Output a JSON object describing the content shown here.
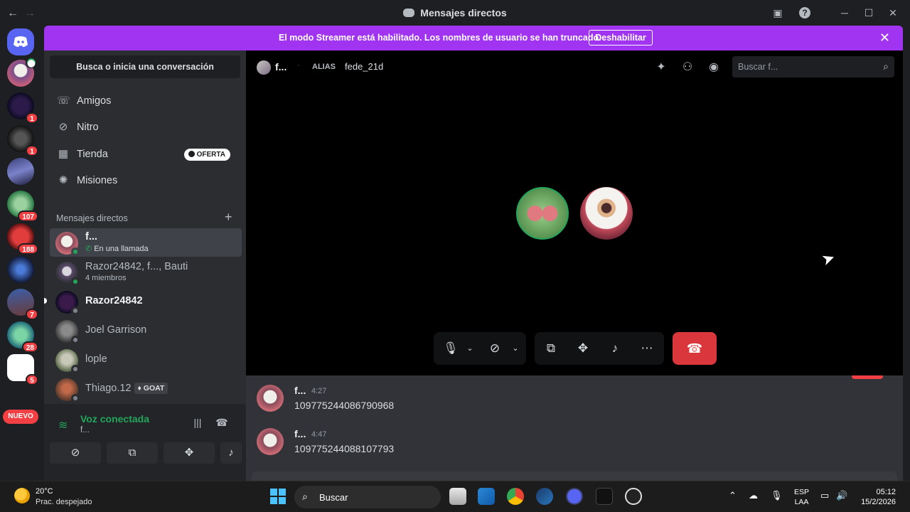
{
  "window": {
    "title": "Mensajes directos"
  },
  "banner": {
    "text": "El modo Streamer está habilitado. Los nombres de usuario se han truncado.",
    "button_label": "Deshabilitar"
  },
  "servers": [
    {
      "badge": ""
    },
    {
      "badge": "1"
    },
    {
      "badge": "1"
    },
    {
      "badge": ""
    },
    {
      "badge": "107"
    },
    {
      "badge": "188"
    },
    {
      "badge": ""
    },
    {
      "badge": "7"
    },
    {
      "badge": "28"
    },
    {
      "badge": "5"
    }
  ],
  "servers_new_pill": "NUEVO",
  "sidebar": {
    "search_placeholder": "Busca o inicia una conversación",
    "nav": [
      {
        "label": "Amigos",
        "icon": "friends-icon"
      },
      {
        "label": "Nitro",
        "icon": "nitro-icon"
      },
      {
        "label": "Tienda",
        "icon": "shop-icon",
        "badge": "OFERTA"
      },
      {
        "label": "Misiones",
        "icon": "quests-icon"
      }
    ],
    "dm_header": "Mensajes directos",
    "dms": [
      {
        "name": "f...",
        "sub": "En una llamada"
      },
      {
        "name": "Razor24842, f..., Bauti",
        "sub": "4 miembros"
      },
      {
        "name": "Razor24842",
        "sub": ""
      },
      {
        "name": "Joel Garrison",
        "sub": ""
      },
      {
        "name": "lople",
        "sub": ""
      },
      {
        "name": "Thiago.12",
        "sub": "",
        "tag": "GOAT"
      }
    ]
  },
  "voice_panel": {
    "title": "Voz conectada",
    "channel": "f..."
  },
  "call": {
    "user": "f...",
    "alias_label": "ALIAS",
    "alias_value": "fede_21d",
    "search_placeholder": "Buscar f..."
  },
  "messages": [
    {
      "author": "f...",
      "time": "4:27",
      "text": "1097752440867909​68"
    },
    {
      "author": "f...",
      "time": "4:47",
      "text": "109775244088107793"
    }
  ],
  "taskbar": {
    "temperature": "20°C",
    "condition": "Prac. despejado",
    "search_label": "Buscar",
    "lang_1": "ESP",
    "lang_2": "LAA",
    "time": "05:12",
    "date": "15/2/2026"
  },
  "colors": {
    "accent": "#5865f2",
    "streamer_banner": "#a034f0",
    "hangup": "#da373c",
    "online": "#23a55a",
    "badge": "#f23f43"
  }
}
